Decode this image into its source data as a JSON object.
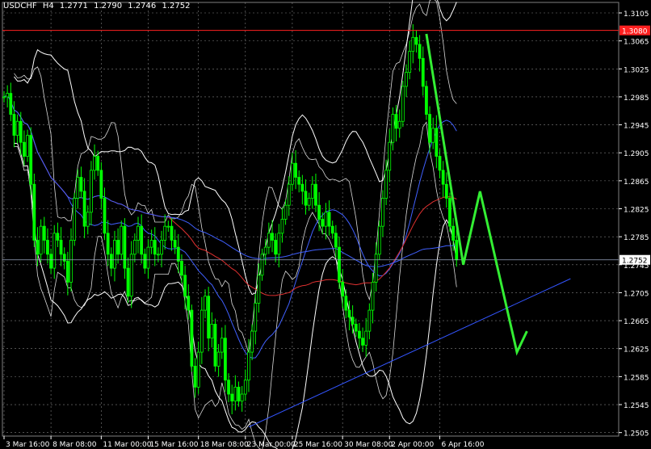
{
  "chart_data": {
    "type": "candlestick",
    "symbol": "USDCHF",
    "timeframe": "H4",
    "ohlc": {
      "open": "1.2771",
      "high": "1.2790",
      "low": "1.2746",
      "close": "1.2752"
    },
    "y_range": [
      1.25,
      1.312
    ],
    "y_ticks": [
      "1.3105",
      "1.3065",
      "1.3025",
      "1.2985",
      "1.2945",
      "1.2905",
      "1.2865",
      "1.2825",
      "1.2785",
      "1.2745",
      "1.2705",
      "1.2665",
      "1.2625",
      "1.2585",
      "1.2545",
      "1.2505"
    ],
    "x_labels": [
      {
        "label": "3 Mar 16:00",
        "bar": 0
      },
      {
        "label": "8 Mar 08:00",
        "bar": 14
      },
      {
        "label": "11 Mar 00:00",
        "bar": 29
      },
      {
        "label": "15 Mar 16:00",
        "bar": 43
      },
      {
        "label": "18 Mar 08:00",
        "bar": 58
      },
      {
        "label": "23 Mar 00:00",
        "bar": 72
      },
      {
        "label": "25 Mar 16:00",
        "bar": 86
      },
      {
        "label": "30 Mar 08:00",
        "bar": 101
      },
      {
        "label": "2 Apr 00:00",
        "bar": 115
      },
      {
        "label": "6 Apr 16:00",
        "bar": 130
      }
    ],
    "last_price_label": "1.2752",
    "last_price": 1.2752,
    "resistance_label": "1.3080",
    "resistance_price": 1.308,
    "close_series": [
      1.2985,
      1.299,
      1.296,
      1.293,
      1.295,
      1.292,
      1.29,
      1.293,
      1.286,
      1.278,
      1.276,
      1.28,
      1.278,
      1.276,
      1.274,
      1.279,
      1.278,
      1.276,
      1.275,
      1.272,
      1.278,
      1.284,
      1.287,
      1.285,
      1.28,
      1.282,
      1.288,
      1.29,
      1.288,
      1.284,
      1.279,
      1.276,
      1.274,
      1.278,
      1.276,
      1.28,
      1.274,
      1.27,
      1.276,
      1.278,
      1.28,
      1.276,
      1.274,
      1.277,
      1.278,
      1.276,
      1.276,
      1.278,
      1.28,
      1.28,
      1.278,
      1.277,
      1.275,
      1.273,
      1.27,
      1.268,
      1.26,
      1.257,
      1.262,
      1.268,
      1.27,
      1.264,
      1.266,
      1.26,
      1.262,
      1.264,
      1.258,
      1.256,
      1.255,
      1.257,
      1.255,
      1.256,
      1.258,
      1.262,
      1.265,
      1.269,
      1.273,
      1.276,
      1.277,
      1.279,
      1.278,
      1.276,
      1.279,
      1.281,
      1.283,
      1.286,
      1.289,
      1.287,
      1.286,
      1.285,
      1.283,
      1.284,
      1.286,
      1.283,
      1.281,
      1.28,
      1.282,
      1.28,
      1.279,
      1.277,
      1.272,
      1.27,
      1.268,
      1.267,
      1.266,
      1.265,
      1.264,
      1.263,
      1.265,
      1.268,
      1.272,
      1.276,
      1.28,
      1.284,
      1.288,
      1.292,
      1.296,
      1.294,
      1.295,
      1.3,
      1.302,
      1.305,
      1.307,
      1.306,
      1.304,
      1.3,
      1.296,
      1.292,
      1.294,
      1.29,
      1.288,
      1.286,
      1.284,
      1.28,
      1.278,
      1.2752
    ],
    "overlay_arrow": [
      [
        1.3075,
        126
      ],
      [
        1.2745,
        137
      ],
      [
        1.285,
        142
      ],
      [
        1.262,
        153
      ],
      [
        1.265,
        156
      ]
    ],
    "trend_line": [
      [
        1.2513,
        73
      ],
      [
        1.2725,
        169
      ]
    ],
    "colors": {
      "background": "#000000",
      "grid": "#808080",
      "axis_text": "#ffffff",
      "candles": "#00ff00",
      "bands": "#ffffff",
      "ma_blue": "#4060ff",
      "ma_red": "#e03030",
      "resistance": "#ff2020",
      "arrow": "#33ee33",
      "trend_line": "#3355ff",
      "price_marker": "#ffffff"
    }
  }
}
